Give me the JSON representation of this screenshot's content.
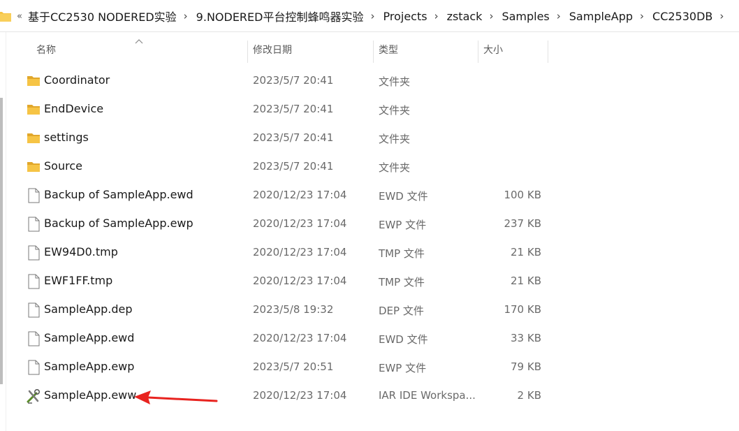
{
  "breadcrumb": {
    "overflow": "«",
    "items": [
      "基于CC2530 NODERED实验",
      "9.NODERED平台控制蜂鸣器实验",
      "Projects",
      "zstack",
      "Samples",
      "SampleApp",
      "CC2530DB"
    ]
  },
  "columns": {
    "name": "名称",
    "modified": "修改日期",
    "type": "类型",
    "size": "大小"
  },
  "files": [
    {
      "icon": "folder-icon",
      "name": "Coordinator",
      "modified": "2023/5/7 20:41",
      "type": "文件夹",
      "size": ""
    },
    {
      "icon": "folder-icon",
      "name": "EndDevice",
      "modified": "2023/5/7 20:41",
      "type": "文件夹",
      "size": ""
    },
    {
      "icon": "folder-icon",
      "name": "settings",
      "modified": "2023/5/7 20:41",
      "type": "文件夹",
      "size": ""
    },
    {
      "icon": "folder-icon",
      "name": "Source",
      "modified": "2023/5/7 20:41",
      "type": "文件夹",
      "size": ""
    },
    {
      "icon": "file-icon",
      "name": "Backup of SampleApp.ewd",
      "modified": "2020/12/23 17:04",
      "type": "EWD 文件",
      "size": "100 KB"
    },
    {
      "icon": "file-icon",
      "name": "Backup of SampleApp.ewp",
      "modified": "2020/12/23 17:04",
      "type": "EWP 文件",
      "size": "237 KB"
    },
    {
      "icon": "file-icon",
      "name": "EW94D0.tmp",
      "modified": "2020/12/23 17:04",
      "type": "TMP 文件",
      "size": "21 KB"
    },
    {
      "icon": "file-icon",
      "name": "EWF1FF.tmp",
      "modified": "2020/12/23 17:04",
      "type": "TMP 文件",
      "size": "21 KB"
    },
    {
      "icon": "file-icon",
      "name": "SampleApp.dep",
      "modified": "2023/5/8 19:32",
      "type": "DEP 文件",
      "size": "170 KB"
    },
    {
      "icon": "file-icon",
      "name": "SampleApp.ewd",
      "modified": "2020/12/23 17:04",
      "type": "EWD 文件",
      "size": "33 KB"
    },
    {
      "icon": "file-icon",
      "name": "SampleApp.ewp",
      "modified": "2023/5/7 20:51",
      "type": "EWP 文件",
      "size": "79 KB"
    },
    {
      "icon": "iar-workspace-icon",
      "name": "SampleApp.eww",
      "modified": "2020/12/23 17:04",
      "type": "IAR IDE Workspa...",
      "size": "2 KB"
    }
  ],
  "annotation": {
    "icon": "red-arrow-icon",
    "color": "#e8231f"
  },
  "colors": {
    "folder": "#f6c445",
    "folder_dark": "#e1a72b",
    "text": "#1a1a1a",
    "secondary": "#6a6a6a"
  }
}
